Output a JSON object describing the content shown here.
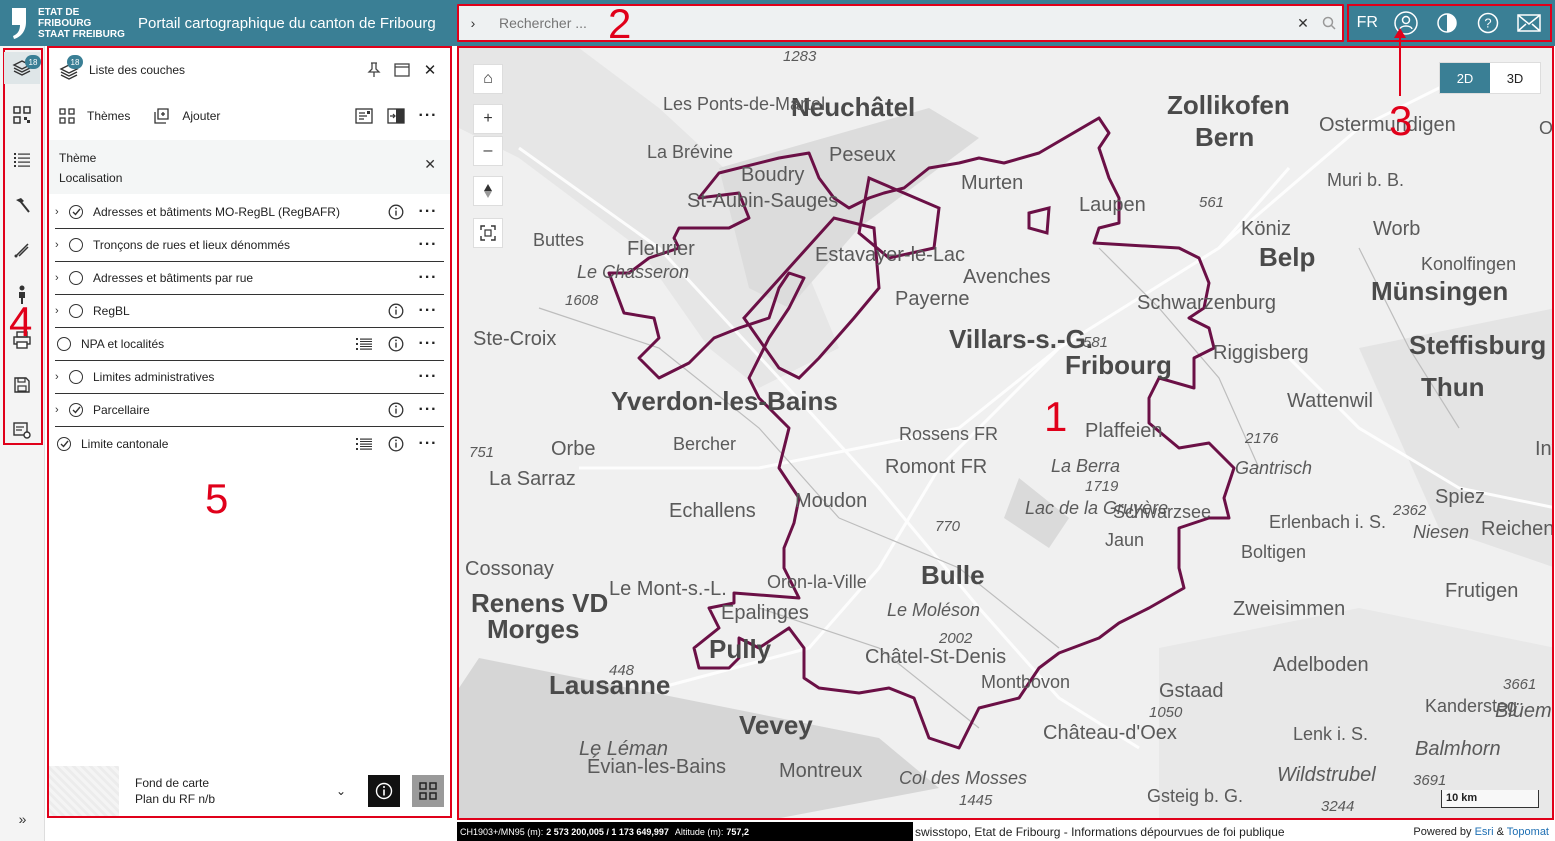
{
  "header": {
    "brand_line1": "ETAT DE FRIBOURG",
    "brand_line2": "STAAT FREIBURG",
    "title": "Portail cartographique du canton de Fribourg",
    "search_placeholder": "Rechercher ...",
    "language": "FR",
    "accent_color": "#3a7f95"
  },
  "sidebar": {
    "layer_count": "18",
    "items": [
      "layers-icon",
      "qr-code-icon",
      "list-icon",
      "hammer-icon",
      "measure-icon",
      "person-icon",
      "print-icon",
      "save-icon",
      "settings-icon"
    ],
    "expand_label": "»"
  },
  "panel": {
    "badge": "18",
    "title": "Liste des couches",
    "themes_label": "Thèmes",
    "add_label": "Ajouter",
    "theme_label": "Thème",
    "theme_value": "Localisation",
    "layers": [
      {
        "name": "Adresses et bâtiments MO-RegBL (RegBAFR)",
        "checked": true,
        "expandable": true,
        "info": true,
        "legend": false
      },
      {
        "name": "Tronçons de rues et lieux dénommés",
        "checked": false,
        "expandable": true,
        "info": false,
        "legend": false
      },
      {
        "name": "Adresses et bâtiments par rue",
        "checked": false,
        "expandable": true,
        "info": false,
        "legend": false
      },
      {
        "name": "RegBL",
        "checked": false,
        "expandable": true,
        "info": true,
        "legend": false
      },
      {
        "name": "NPA et localités",
        "checked": false,
        "expandable": false,
        "info": true,
        "legend": true
      },
      {
        "name": "Limites administratives",
        "checked": false,
        "expandable": true,
        "info": false,
        "legend": false
      },
      {
        "name": "Parcellaire",
        "checked": true,
        "expandable": true,
        "info": true,
        "legend": false
      },
      {
        "name": "Limite cantonale",
        "checked": true,
        "expandable": false,
        "info": true,
        "legend": true
      }
    ],
    "basemap_label": "Fond de carte",
    "basemap_value": "Plan du RF n/b"
  },
  "annotations": {
    "n1": "1",
    "n2": "2",
    "n3": "3",
    "n4": "4",
    "n5": "5"
  },
  "map": {
    "view_2d": "2D",
    "view_3d": "3D",
    "scale": "10 km",
    "places": [
      "Neuchâtel",
      "Bern",
      "Zollikofen",
      "Ostermundigen",
      "Murten",
      "Fribourg",
      "Bulle",
      "Lausanne",
      "Vevey",
      "Yverdon-les-Bains",
      "Romont FR",
      "Thun",
      "Steffisburg",
      "Münsingen",
      "Belp",
      "Köniz",
      "Schwarzenburg",
      "Riggisberg",
      "Plaffeien",
      "Châtel-St-Denis",
      "Gstaad",
      "Château-d'Oex",
      "Montreux",
      "Pully",
      "Morges",
      "Renens VD",
      "Payerne",
      "Avenches",
      "Estavayer-le-Lac",
      "Villars-s.-G.",
      "La Berra",
      "Jaun",
      "Zweisimmen",
      "Adelboden",
      "Spiez",
      "Erlenbach i. S.",
      "Boltigen",
      "Lenk i. S.",
      "Frutigen",
      "Echallens",
      "Orbe",
      "Fleurier",
      "Boudry",
      "St-Aubin-Sauges",
      "Peseux",
      "Laupen",
      "Moudon",
      "Oron-la-Ville",
      "Epalinges",
      "Le Mont-s.-L.",
      "Cossonay",
      "La Sarraz",
      "Bercher",
      "Ste-Croix",
      "Buttes",
      "La Brévine",
      "Les Ponts-de-Martel",
      "Worb",
      "Konolfingen",
      "Wattenwil",
      "Gantrisch",
      "Rossens FR",
      "Montbovon",
      "Col des Mosses",
      "Gsteig b. G.",
      "Évian-les-Bains",
      "Kandersteg",
      "Balmhorn",
      "Wildstrubel",
      "Blüem",
      "Le Moléson",
      "Lac de la Gruyère",
      "Le Chasseron",
      "Schwarzsee",
      "Le Léman",
      "Reichenbach i. K.",
      "Niesen",
      "Muri b. B.",
      "Oberhofen",
      "Inter"
    ],
    "elevations": [
      "1283",
      "1608",
      "751",
      "561",
      "581",
      "2176",
      "1719",
      "770",
      "2002",
      "448",
      "1050",
      "1445",
      "3244",
      "3691",
      "3661",
      "2362"
    ]
  },
  "footer": {
    "coords_label": "CH1903+/MN95 (m):",
    "coords_value": "2 573 200,005 / 1 173 649,997",
    "alt_label": "Altitude (m):",
    "alt_value": "757,2",
    "attribution": "swisstopo, Etat de Fribourg - Informations dépourvues de foi publique",
    "powered_prefix": "Powered by",
    "esri": "Esri",
    "amp": "&",
    "topomat": "Topomat"
  }
}
